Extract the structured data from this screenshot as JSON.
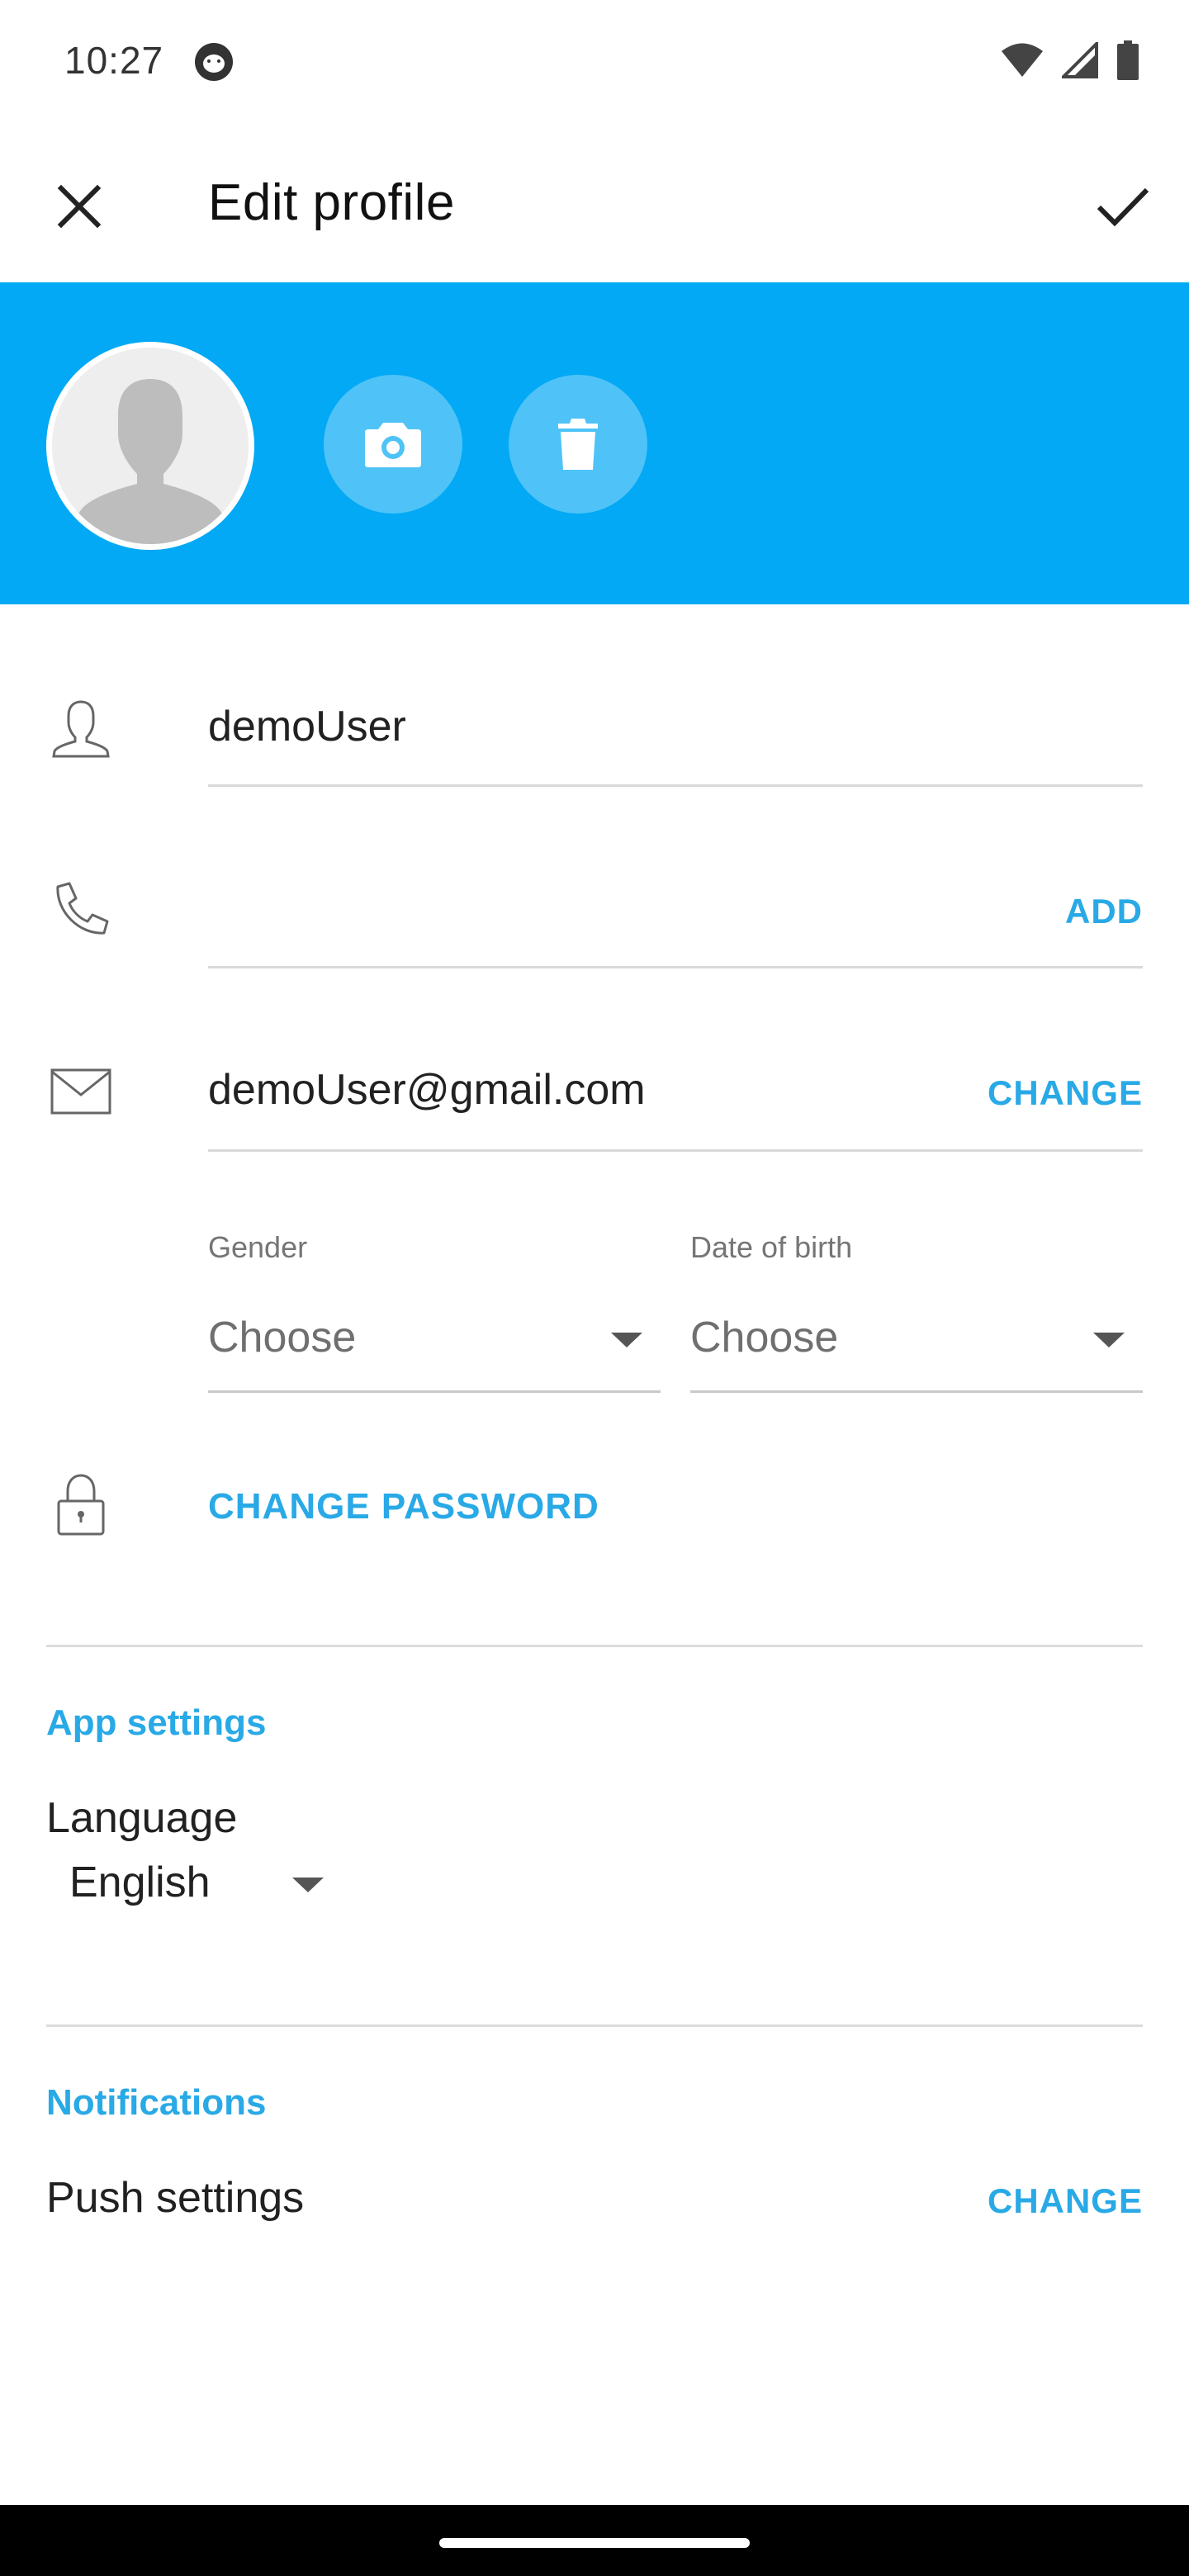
{
  "status_bar": {
    "time": "10:27"
  },
  "app_bar": {
    "title": "Edit profile"
  },
  "profile": {
    "username": "demoUser",
    "phone_action": "ADD",
    "email": "demoUser@gmail.com",
    "email_action": "CHANGE",
    "gender_label": "Gender",
    "gender_value": "Choose",
    "dob_label": "Date of birth",
    "dob_value": "Choose",
    "password_action": "CHANGE PASSWORD"
  },
  "app_settings": {
    "title": "App settings",
    "language_label": "Language",
    "language_value": "English"
  },
  "notifications": {
    "title": "Notifications",
    "push_label": "Push settings",
    "push_action": "CHANGE"
  },
  "colors": {
    "accent": "#03a9f4",
    "link": "#29a9e6",
    "action_circle": "#4fc3f7"
  },
  "icons": [
    "close-icon",
    "check-icon",
    "camera-icon",
    "trash-icon",
    "person-icon",
    "phone-icon",
    "mail-icon",
    "lock-icon",
    "chevron-down-icon",
    "wifi-icon",
    "signal-icon",
    "battery-icon"
  ]
}
